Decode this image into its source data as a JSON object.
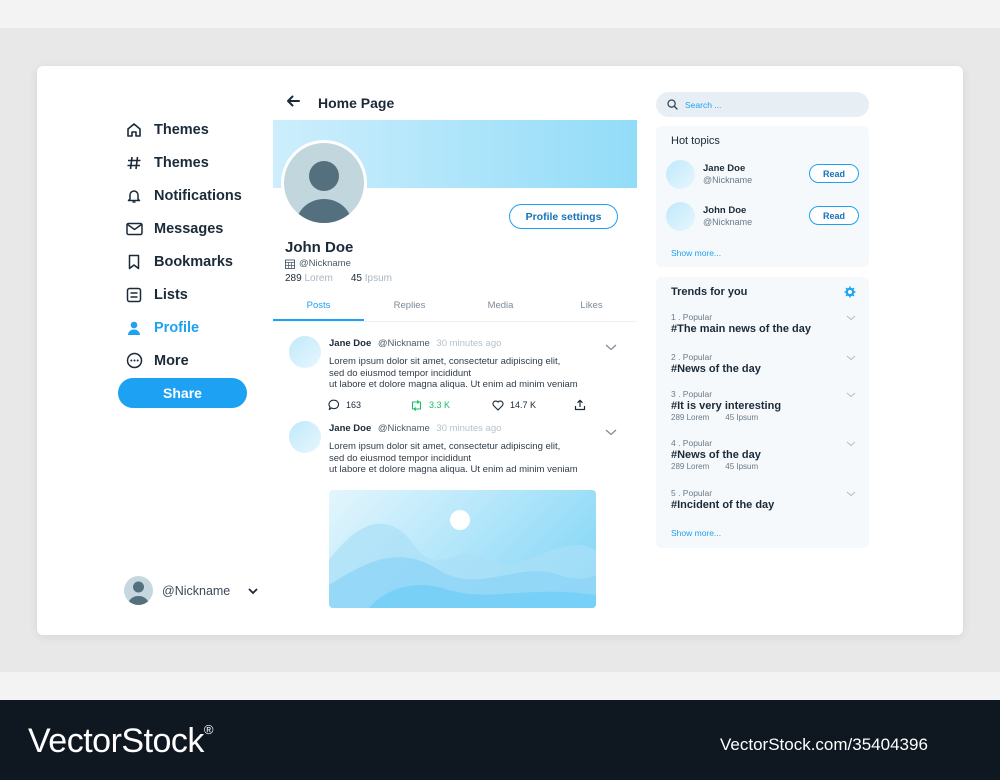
{
  "sidebar": {
    "items": [
      {
        "label": "Themes",
        "icon": "home-icon"
      },
      {
        "label": "Themes",
        "icon": "hashtag-icon"
      },
      {
        "label": "Notifications",
        "icon": "bell-icon"
      },
      {
        "label": "Messages",
        "icon": "envelope-icon"
      },
      {
        "label": "Bookmarks",
        "icon": "bookmark-icon"
      },
      {
        "label": "Lists",
        "icon": "list-icon"
      },
      {
        "label": "Profile",
        "icon": "user-icon",
        "active": true
      },
      {
        "label": "More",
        "icon": "more-icon"
      }
    ],
    "share_label": "Share",
    "account_nick": "@Nickname"
  },
  "header": {
    "title": "Home Page"
  },
  "profile": {
    "name": "John Doe",
    "nick": "@Nickname",
    "settings_label": "Profile settings",
    "stat1_num": "289",
    "stat1_unit": "Lorem",
    "stat2_num": "45",
    "stat2_unit": "Ipsum"
  },
  "tabs": [
    "Posts",
    "Replies",
    "Media",
    "Likes"
  ],
  "posts": [
    {
      "author": "Jane Doe",
      "nick": "@Nickname",
      "time": "30 minutes ago",
      "lines": [
        "Lorem ipsum dolor sit amet, consectetur adipiscing elit,",
        "sed do eiusmod tempor incididunt",
        "ut labore et dolore magna aliqua. Ut enim ad minim veniam"
      ]
    },
    {
      "author": "Jane Doe",
      "nick": "@Nickname",
      "time": "30 minutes ago",
      "lines": [
        "Lorem ipsum dolor sit amet, consectetur adipiscing elit,",
        "sed do eiusmod tempor incididunt",
        "ut labore et dolore magna aliqua. Ut enim ad minim veniam"
      ]
    }
  ],
  "post_actions": {
    "comments": "163",
    "retweets": "3.3 K",
    "likes": "14.7 K"
  },
  "search": {
    "placeholder": "Search ..."
  },
  "hot_topics": {
    "title": "Hot topics",
    "items": [
      {
        "name": "Jane Doe",
        "nick": "@Nickname",
        "button": "Read"
      },
      {
        "name": "John Doe",
        "nick": "@Nickname",
        "button": "Read"
      }
    ],
    "show_more": "Show more..."
  },
  "trends": {
    "title": "Trends for you",
    "items": [
      {
        "rank": "1 . Popular",
        "tag": "#The main news of the day"
      },
      {
        "rank": "2 . Popular",
        "tag": "#News of the day"
      },
      {
        "rank": "3 . Popular",
        "tag": "#It is very interesting",
        "stat1": "289 Lorem",
        "stat2": "45 Ipsum"
      },
      {
        "rank": "4 . Popular",
        "tag": "#News of the day",
        "stat1": "289 Lorem",
        "stat2": "45 Ipsum"
      },
      {
        "rank": "5 . Popular",
        "tag": "#Incident of the day"
      }
    ],
    "show_more": "Show more..."
  },
  "colors": {
    "accent": "#1da1f2",
    "text": "#1b2a38",
    "panel": "#f5f9fb",
    "retweet": "#17bf63"
  },
  "watermark": {
    "logo": "VectorStock",
    "reg": "®",
    "id": "VectorStock.com/35404396"
  }
}
